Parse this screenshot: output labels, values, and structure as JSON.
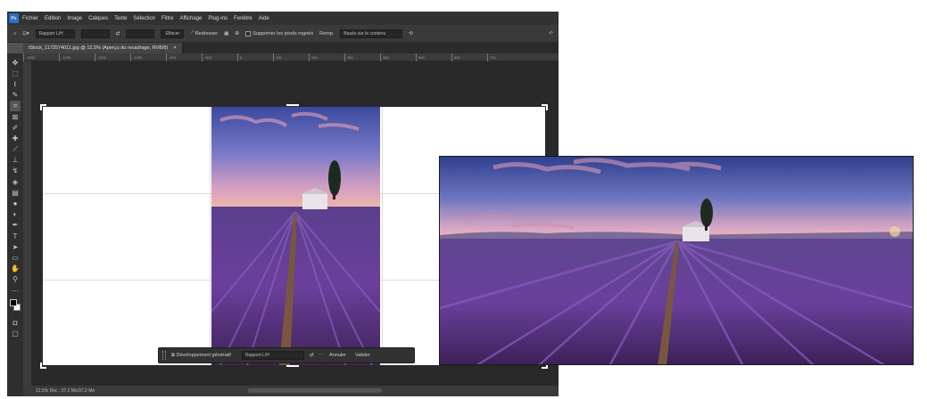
{
  "app": {
    "name": "Photoshop",
    "logo_text": "Ps",
    "menus": [
      "Fichier",
      "Edition",
      "Image",
      "Calques",
      "Texte",
      "Sélection",
      "Filtre",
      "Affichage",
      "Plug-ins",
      "Fenêtre",
      "Aide"
    ]
  },
  "options_bar": {
    "ratio_value": "Rapport L/H",
    "clear_label": "Effacer",
    "straighten_label": "Redresser",
    "delete_pixels_label": "Supprimer les pixels rognés",
    "fill_label": "Remp.",
    "fill_value": "Basée sur le contenu"
  },
  "document": {
    "tab_label": "iStock_1172574011.jpg @ 12,5% (Aperçu du recadrage, RVB/8)",
    "ruler_ticks": [
      "-1300",
      "-1200",
      "-1100",
      "-1000",
      "-900",
      "-800",
      "0",
      "100",
      "200",
      "300",
      "400",
      "500",
      "600",
      "700"
    ],
    "status_text": "12,5%   Doc : 37,2 Mo/37,2 Mo"
  },
  "contextual_bar": {
    "generative_label": "Développement génératif",
    "ratio_label": "Rapport L/H",
    "cancel_label": "Annuler",
    "validate_label": "Valider"
  },
  "tools": [
    "move-tool-icon",
    "marquee-tool-icon",
    "lasso-tool-icon",
    "quick-select-tool-icon",
    "crop-tool-icon",
    "frame-tool-icon",
    "eyedropper-tool-icon",
    "healing-tool-icon",
    "brush-tool-icon",
    "clone-stamp-tool-icon",
    "history-brush-tool-icon",
    "eraser-tool-icon",
    "gradient-tool-icon",
    "blur-tool-icon",
    "dodge-tool-icon",
    "pen-tool-icon",
    "type-tool-icon",
    "path-select-tool-icon",
    "shape-tool-icon",
    "hand-tool-icon",
    "zoom-tool-icon",
    "more-tools-icon"
  ],
  "colors": {
    "ui_dark": "#323232",
    "ui_mid": "#535353",
    "sky_top": "#3b4a9e",
    "sky_horizon": "#e7a9b6",
    "lavender": "#6b3f9c"
  }
}
